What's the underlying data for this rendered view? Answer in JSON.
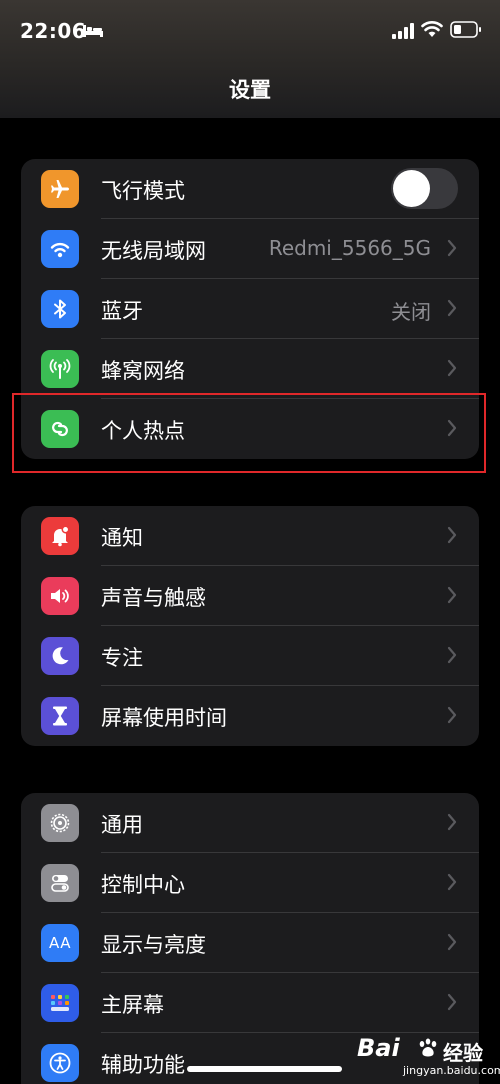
{
  "status_bar": {
    "time": "22:06"
  },
  "nav": {
    "title": "设置"
  },
  "groups": [
    {
      "rows": [
        {
          "label": "飞行模式",
          "icon": "airplane-icon",
          "color": "#f0962c",
          "toggle": "off"
        },
        {
          "label": "无线局域网",
          "icon": "wifi-icon",
          "color": "#2f7cf6",
          "value": "Redmi_5566_5G"
        },
        {
          "label": "蓝牙",
          "icon": "bluetooth-icon",
          "color": "#2f7cf6",
          "value": "关闭"
        },
        {
          "label": "蜂窝网络",
          "icon": "antenna-icon",
          "color": "#3bbd54"
        },
        {
          "label": "个人热点",
          "icon": "hotspot-link-icon",
          "color": "#3bbd54",
          "highlighted": true
        }
      ]
    },
    {
      "rows": [
        {
          "label": "通知",
          "icon": "bell-icon",
          "color": "#ec3b3b"
        },
        {
          "label": "声音与触感",
          "icon": "speaker-icon",
          "color": "#ea3c5b"
        },
        {
          "label": "专注",
          "icon": "moon-icon",
          "color": "#5b50d6"
        },
        {
          "label": "屏幕使用时间",
          "icon": "hourglass-icon",
          "color": "#5b50d6"
        }
      ]
    },
    {
      "rows": [
        {
          "label": "通用",
          "icon": "gear-icon",
          "color": "#8e8e93"
        },
        {
          "label": "控制中心",
          "icon": "switches-icon",
          "color": "#8e8e93"
        },
        {
          "label": "显示与亮度",
          "icon": "text-size-icon",
          "color": "#2f7cf6",
          "icon_text": "AA"
        },
        {
          "label": "主屏幕",
          "icon": "home-grid-icon",
          "color": "#2f5de8"
        },
        {
          "label": "辅助功能",
          "icon": "accessibility-icon",
          "color": "#2f7cf6"
        }
      ]
    }
  ],
  "watermark": {
    "brand": "Bai",
    "suffix": "经验",
    "url": "jingyan.baidu.com"
  }
}
